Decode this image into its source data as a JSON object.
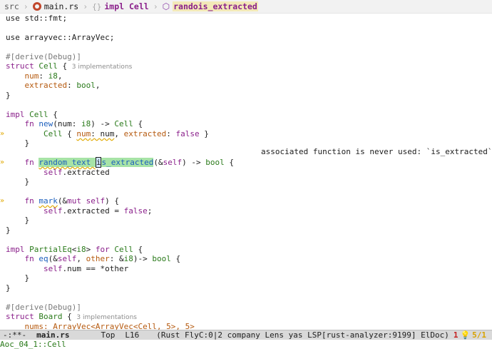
{
  "breadcrumb": {
    "folder": "src",
    "file": "main.rs",
    "impl": "impl Cell",
    "function": "randois_extracted",
    "icons": [
      "rust-icon",
      "braces-icon",
      "cube-icon"
    ]
  },
  "diagnostic": "associated function is never used: `is_extracted`",
  "code": {
    "l1": "use std::fmt;",
    "l3": "use arrayvec::ArrayVec;",
    "l5": "#[derive(Debug)]",
    "l6_kw": "struct",
    "l6_name": "Cell",
    "l6_brace": " {",
    "impl_hint_1": "3 implementations",
    "l7_field": "num",
    "l7_type": "i8",
    "l8_field": "extracted",
    "l8_type": "bool",
    "l9": "}",
    "l11_kw": "impl",
    "l11_name": "Cell",
    "l12_fn": "new",
    "l13_name": "Cell",
    "l17_hl": "random_text ",
    "l17_rest": "is_extracted",
    "l22_fn": "mark",
    "l27_trait": "PartialEq",
    "l28_fn": "eq",
    "l32_attr": "#[derive(Debug)]",
    "l33_name": "Board",
    "impl_hint_2": "3 implementations",
    "l34": "nums: ArrayVec<ArrayVec<Cell, 5>, 5>"
  },
  "modeline": {
    "state": "-:**-",
    "buffer": "main.rs",
    "position": "Top",
    "line": "L16",
    "modes": "(Rust FlyC:0|2 company Lens yas LSP[rust-analyzer:9199] ElDoc)",
    "errors": "1",
    "warn_icon": "bulb-icon",
    "warnings": "5/1"
  },
  "echo_area": "Aoc_04_1::Cell"
}
